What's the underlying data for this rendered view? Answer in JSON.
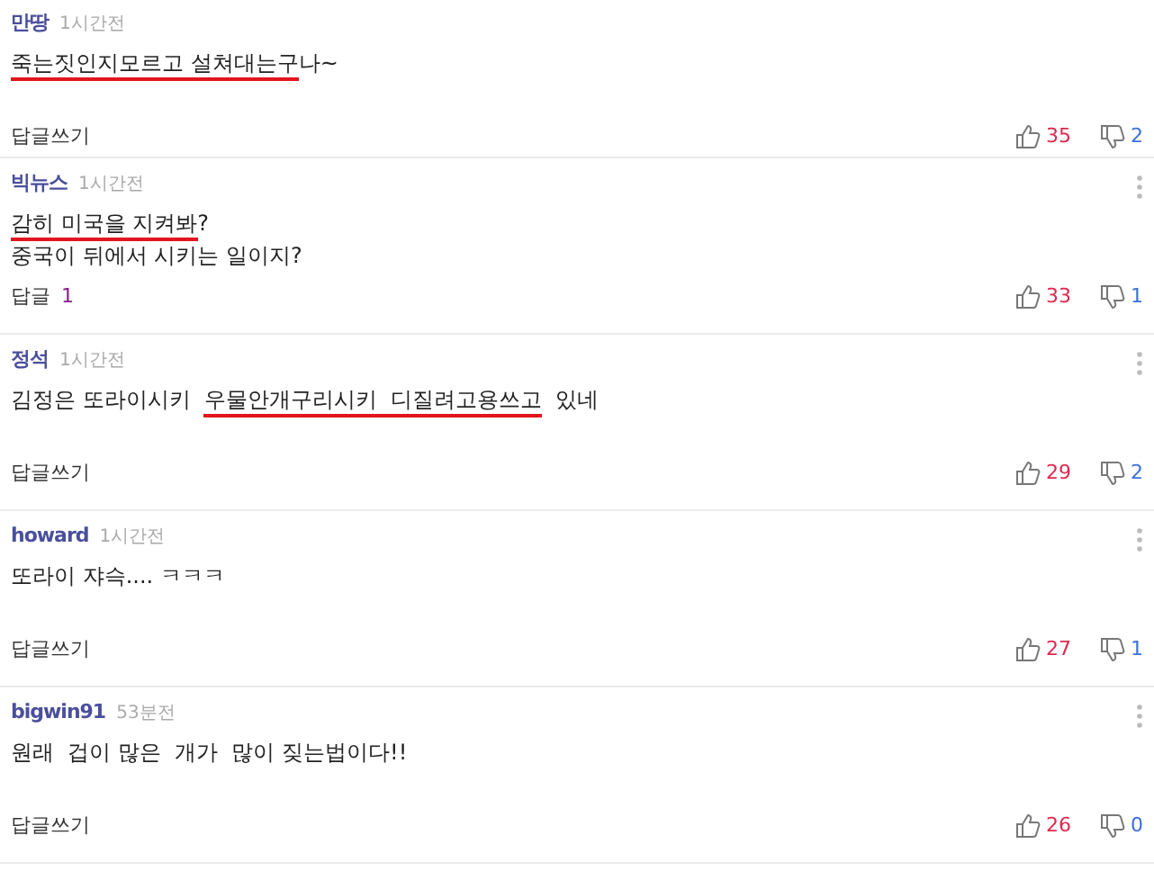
{
  "comments": [
    {
      "author": "만땅",
      "time": "1시간전",
      "menu": false,
      "lines": [
        [
          {
            "text": "죽는짓인지모르고 설쳐대는구",
            "underlined": true
          },
          {
            "text": "나~",
            "underlined": false
          }
        ]
      ],
      "reply": {
        "label": "답글쓰기"
      },
      "likes": "35",
      "dislikes": "2"
    },
    {
      "author": "빅뉴스",
      "time": "1시간전",
      "menu": true,
      "lines": [
        [
          {
            "text": "감히 미국을 지켜봐",
            "underlined": true
          },
          {
            "text": "?",
            "underlined": false
          }
        ],
        [
          {
            "text": "중국이 뒤에서 시키는 일이지?",
            "underlined": false
          }
        ]
      ],
      "reply": {
        "label": "답글",
        "count": "1"
      },
      "likes": "33",
      "dislikes": "1"
    },
    {
      "author": "정석",
      "time": "1시간전",
      "menu": true,
      "lines": [
        [
          {
            "text": "김정은 또라이시키  ",
            "underlined": false
          },
          {
            "text": "우물안개구리시키  디질려고용쓰고",
            "underlined": true
          },
          {
            "text": "  있네",
            "underlined": false
          }
        ]
      ],
      "reply": {
        "label": "답글쓰기"
      },
      "likes": "29",
      "dislikes": "2"
    },
    {
      "author": "howard",
      "time": "1시간전",
      "menu": true,
      "lines": [
        [
          {
            "text": "또라이 쟈슥.... ㅋㅋㅋ",
            "underlined": false
          }
        ]
      ],
      "reply": {
        "label": "답글쓰기"
      },
      "likes": "27",
      "dislikes": "1"
    },
    {
      "author": "bigwin91",
      "time": "53분전",
      "menu": true,
      "lines": [
        [
          {
            "text": "원래  겁이 많은  개가  많이 짖는법이다!!",
            "underlined": false
          }
        ]
      ],
      "reply": {
        "label": "답글쓰기"
      },
      "likes": "26",
      "dislikes": "0"
    }
  ]
}
